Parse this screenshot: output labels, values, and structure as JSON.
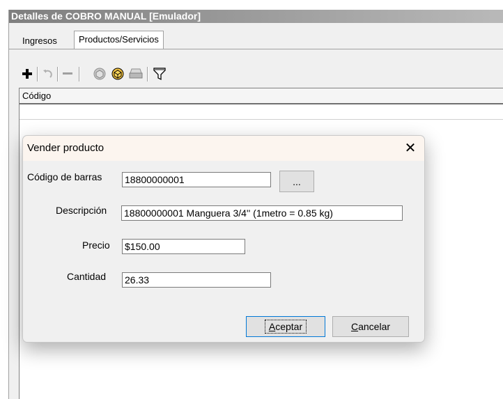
{
  "window": {
    "title": "Detalles de COBRO MANUAL [Emulador]"
  },
  "tabs": [
    {
      "label": "Ingresos",
      "active": false
    },
    {
      "label": "Productos/Servicios",
      "active": true
    }
  ],
  "toolbar": {
    "icons": [
      "plus-icon",
      "undo-icon",
      "minus-icon",
      "box-icon",
      "box-color-icon",
      "printer-icon",
      "filter-icon"
    ]
  },
  "grid": {
    "columns": [
      "Código"
    ]
  },
  "dialog": {
    "title": "Vender producto",
    "close_glyph": "✕",
    "fields": {
      "barcode_label": "Código de barras",
      "barcode_value": "18800000001",
      "browse_label": "...",
      "description_label": "Descripción",
      "description_value": "18800000001 Manguera 3/4'' (1metro = 0.85 kg)",
      "price_label": "Precio",
      "price_value": "$150.00",
      "quantity_label": "Cantidad",
      "quantity_value": "26.33"
    },
    "buttons": {
      "accept_first": "A",
      "accept_rest": "ceptar",
      "cancel_first": "C",
      "cancel_rest": "ancelar"
    }
  },
  "colors": {
    "accent_blue": "#0078d7",
    "title_gray": "#7f7f7f",
    "dialog_title_bg": "#fcf5ef"
  }
}
